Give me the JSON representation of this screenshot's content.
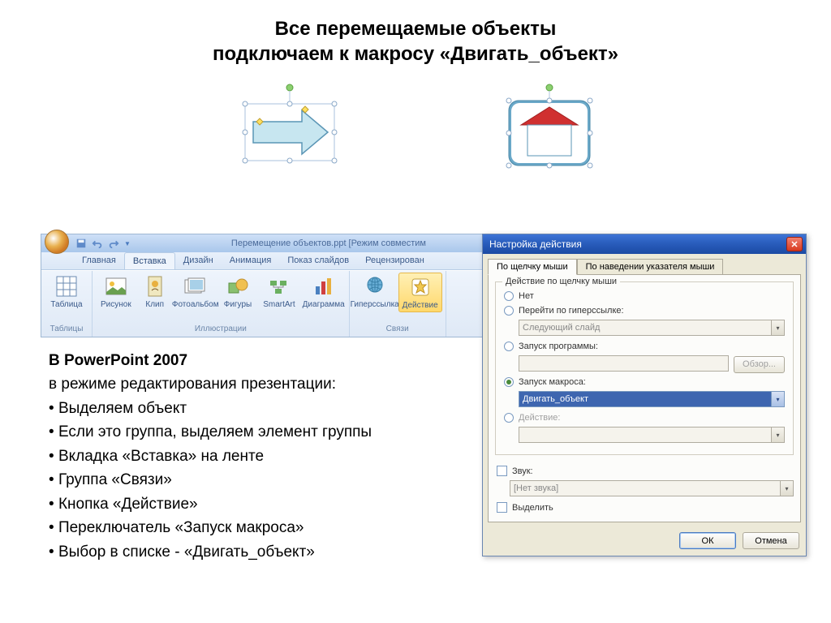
{
  "heading": {
    "line1": "Все перемещаемые объекты",
    "line2": "подключаем к макросу «Двигать_объект»"
  },
  "ribbon": {
    "title": "Перемещение объектов.ppt [Режим совместим",
    "tabs": [
      "Главная",
      "Вставка",
      "Дизайн",
      "Анимация",
      "Показ слайдов",
      "Рецензирован"
    ],
    "groups": {
      "tables": {
        "label": "Таблицы",
        "item": "Таблица"
      },
      "illus": {
        "label": "Иллюстрации",
        "items": [
          "Рисунок",
          "Клип",
          "Фотоальбом",
          "Фигуры",
          "SmartArt",
          "Диаграмма"
        ]
      },
      "links": {
        "label": "Связи",
        "items": [
          "Гиперссылка",
          "Действие"
        ]
      }
    }
  },
  "instructions": {
    "lead": "В PowerPoint 2007",
    "sub": "в режиме редактирования презентации:",
    "items": [
      "Выделяем объект",
      "Если это группа, выделяем элемент группы",
      "Вкладка «Вставка» на ленте",
      "Группа «Связи»",
      "Кнопка «Действие»",
      "Переключатель «Запуск макроса»",
      "Выбор в списке - «Двигать_объект»"
    ]
  },
  "dialog": {
    "title": "Настройка действия",
    "tabs": [
      "По щелчку мыши",
      "По наведении указателя мыши"
    ],
    "group_label": "Действие по щелчку мыши",
    "radio_none": "Нет",
    "radio_hyperlink": "Перейти по гиперссылке:",
    "hyperlink_value": "Следующий слайд",
    "radio_program": "Запуск программы:",
    "browse_btn": "Обзор...",
    "radio_macro": "Запуск макроса:",
    "macro_value": "Двигать_объект",
    "radio_action": "Действие:",
    "sound_label": "Звук:",
    "sound_value": "[Нет звука]",
    "highlight_label": "Выделить",
    "ok": "ОК",
    "cancel": "Отмена"
  }
}
